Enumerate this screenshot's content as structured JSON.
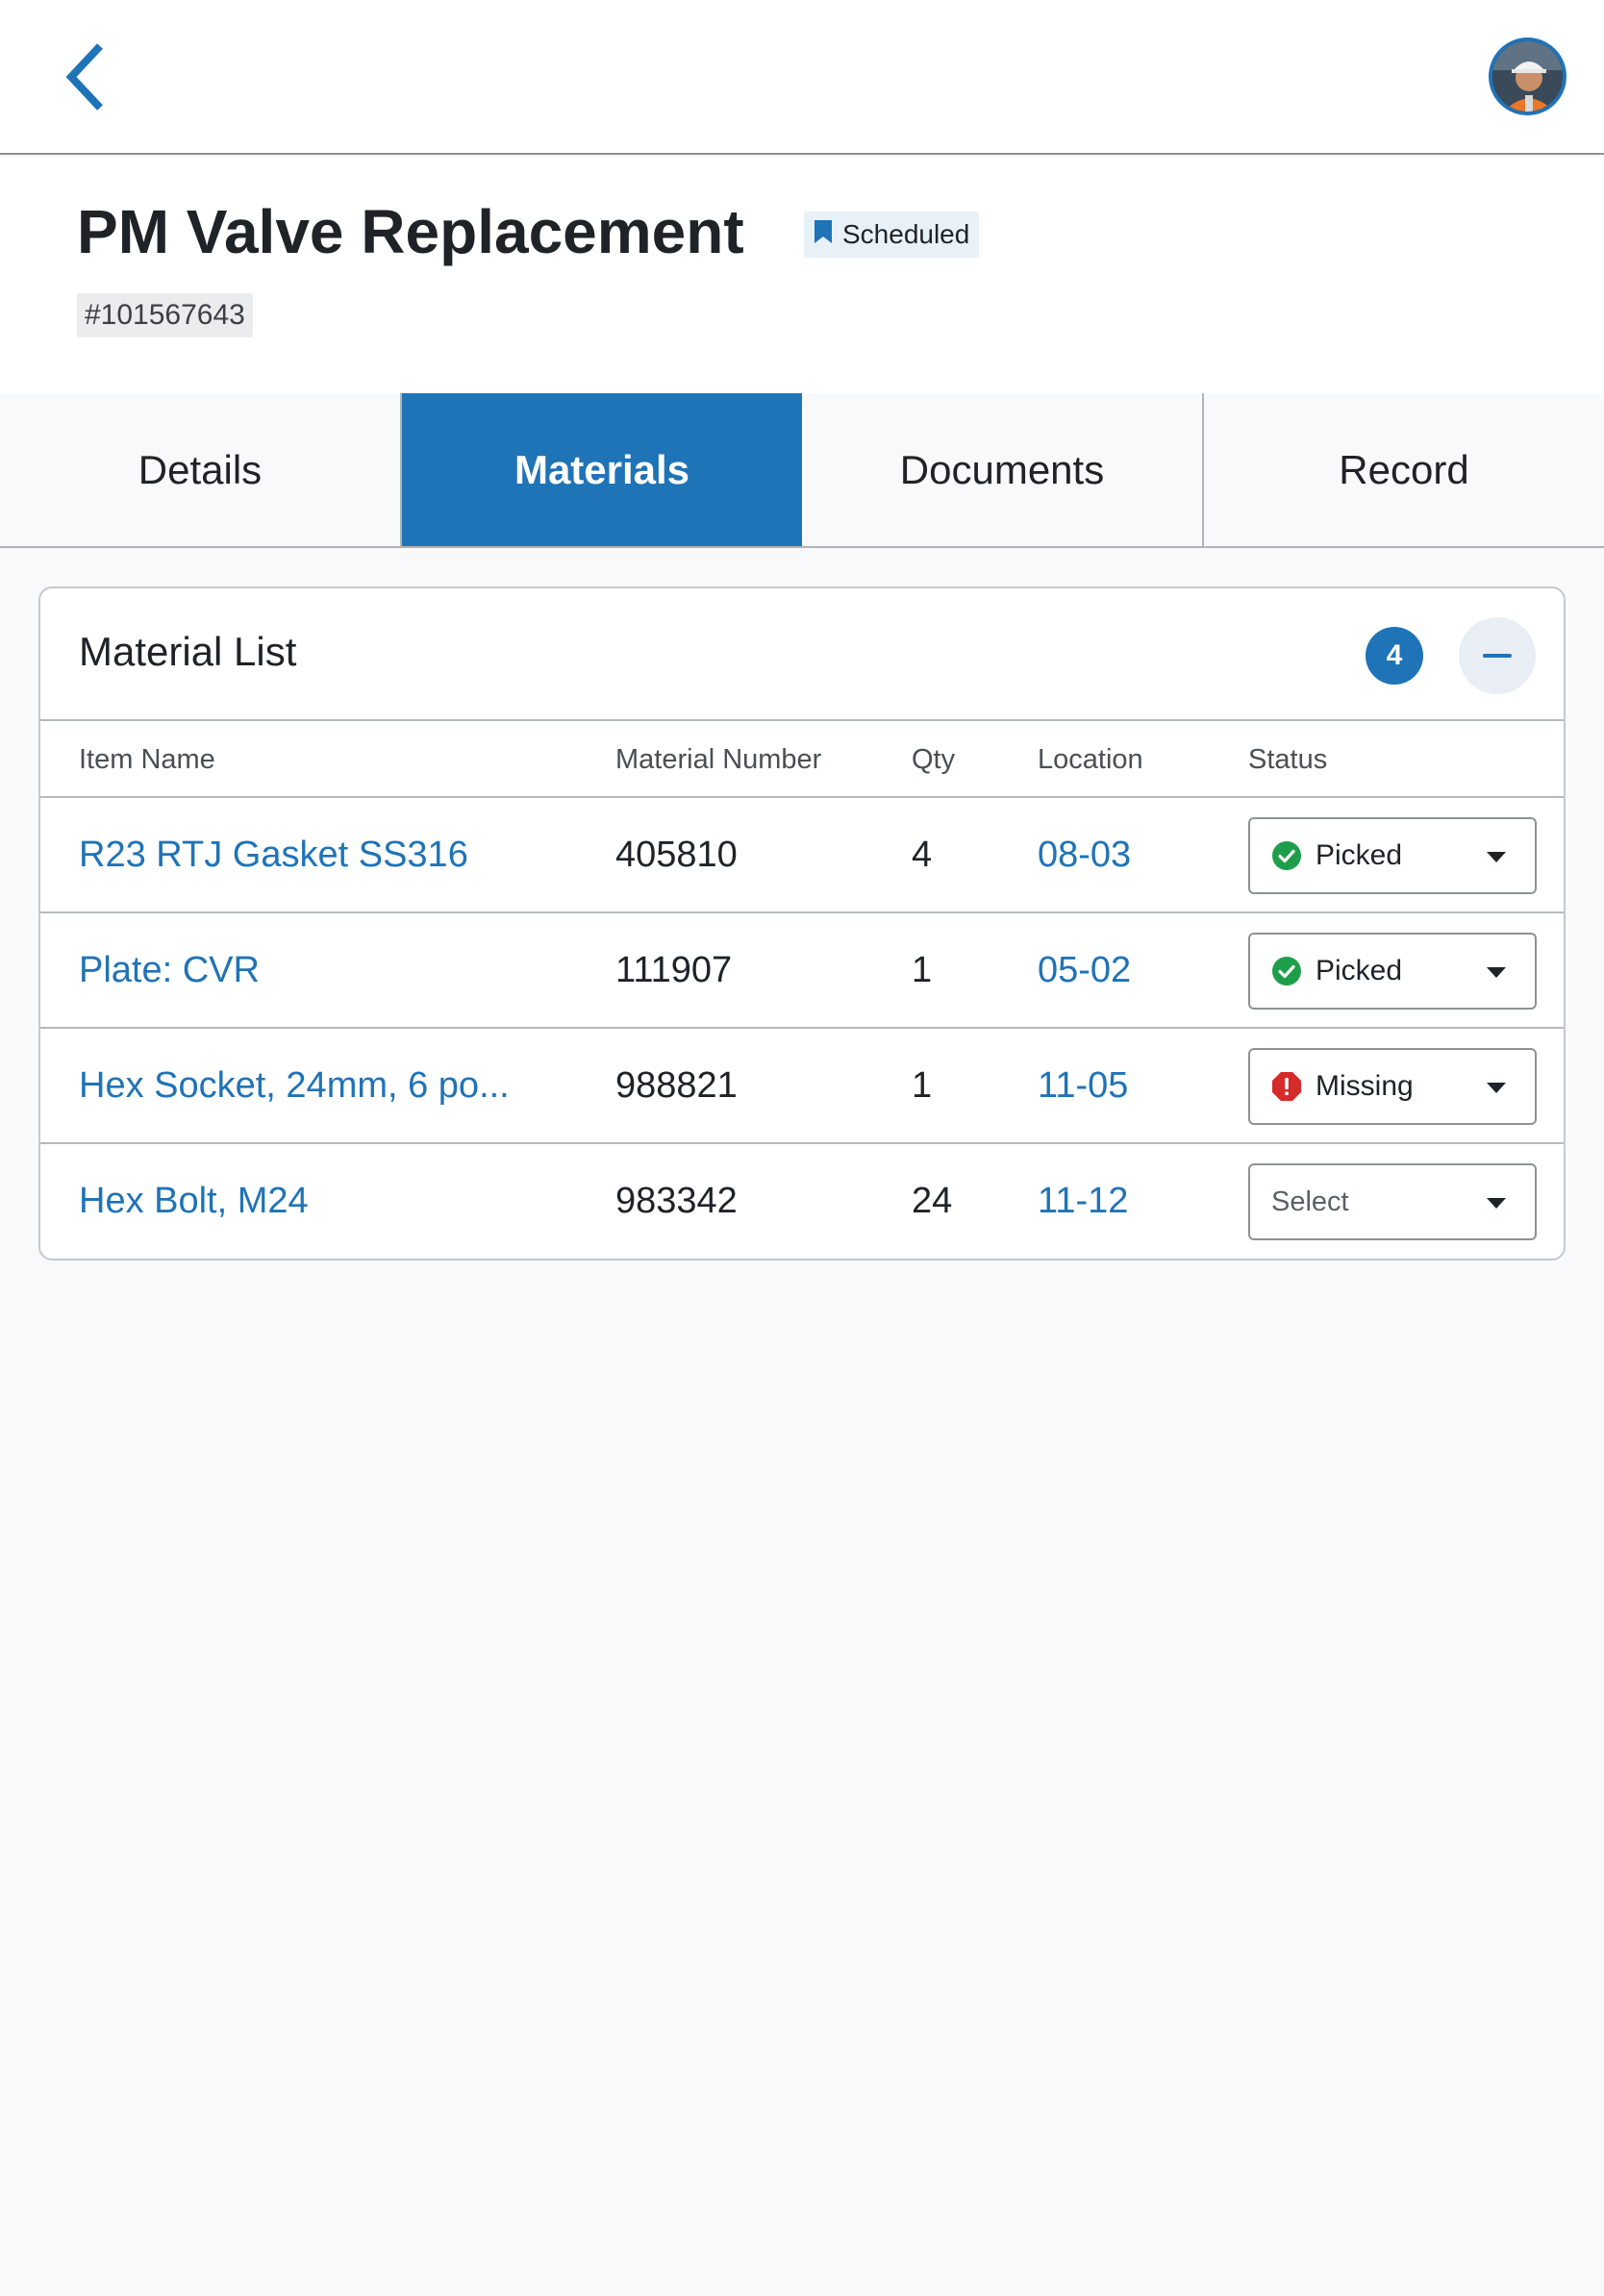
{
  "header": {
    "title": "PM Valve Replacement",
    "status_chip": "Scheduled",
    "work_order_number": "#101567643"
  },
  "tabs": [
    {
      "label": "Details",
      "active": false
    },
    {
      "label": "Materials",
      "active": true
    },
    {
      "label": "Documents",
      "active": false
    },
    {
      "label": "Record",
      "active": false
    }
  ],
  "material_list": {
    "title": "Material List",
    "count": "4",
    "columns": {
      "item_name": "Item Name",
      "material_number": "Material Number",
      "qty": "Qty",
      "location": "Location",
      "status": "Status"
    },
    "rows": [
      {
        "item_name": "R23 RTJ Gasket SS316",
        "material_number": "405810",
        "qty": "4",
        "location": "08-03",
        "status": "Picked",
        "status_icon": "check-circle-icon"
      },
      {
        "item_name": "Plate: CVR",
        "material_number": "111907",
        "qty": "1",
        "location": "05-02",
        "status": "Picked",
        "status_icon": "check-circle-icon"
      },
      {
        "item_name": "Hex Socket, 24mm, 6 po...",
        "material_number": "988821",
        "qty": "1",
        "location": "11-05",
        "status": "Missing",
        "status_icon": "alert-octagon-icon"
      },
      {
        "item_name": "Hex Bolt, M24",
        "material_number": "983342",
        "qty": "24",
        "location": "11-12",
        "status": "Select",
        "status_icon": ""
      }
    ]
  },
  "colors": {
    "accent": "#1f73b7",
    "picked": "#1e9e4a",
    "missing": "#d62b2b",
    "background": "#f8f9fb"
  },
  "icons": {
    "back": "chevron-left-icon",
    "status_chip": "bookmark-icon",
    "collapse": "minus-icon",
    "avatar": "user-avatar"
  }
}
